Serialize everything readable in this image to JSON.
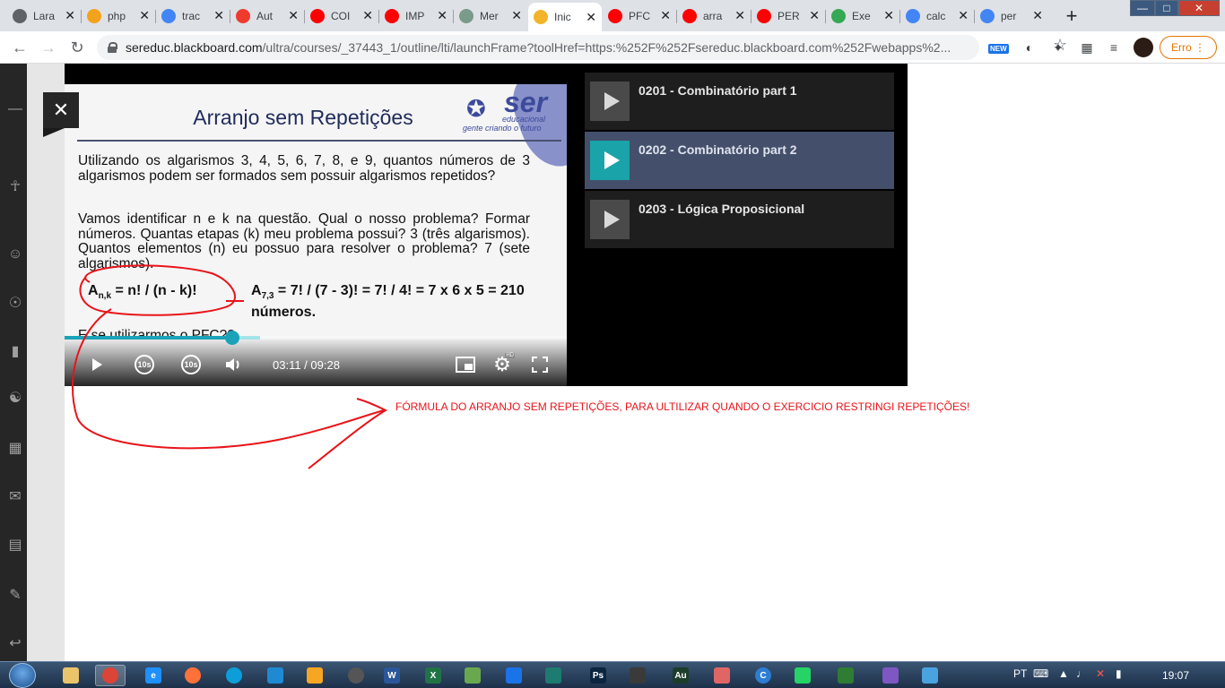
{
  "browser": {
    "tabs": [
      {
        "title": "Lara",
        "favicon": "globe-icon",
        "color": "#5f6368"
      },
      {
        "title": "php",
        "favicon": "php-icon",
        "color": "#f4a21b"
      },
      {
        "title": "trac",
        "favicon": "google-icon",
        "color": "#4285f4"
      },
      {
        "title": "Aut",
        "favicon": "laravel-icon",
        "color": "#ef3b2d"
      },
      {
        "title": "COI",
        "favicon": "youtube-icon",
        "color": "#ff0000"
      },
      {
        "title": "IMP",
        "favicon": "youtube-icon",
        "color": "#ff0000"
      },
      {
        "title": "Mer",
        "favicon": "link-icon",
        "color": "#7a9a8a"
      },
      {
        "title": "Inic",
        "favicon": "blackboard-icon",
        "color": "#f3b32a"
      },
      {
        "title": "PFC",
        "favicon": "youtube-icon",
        "color": "#ff0000"
      },
      {
        "title": "arra",
        "favicon": "youtube-icon",
        "color": "#ff0000"
      },
      {
        "title": "PER",
        "favicon": "youtube-icon",
        "color": "#ff0000"
      },
      {
        "title": "Exe",
        "favicon": "drive-icon",
        "color": "#34a853"
      },
      {
        "title": "calc",
        "favicon": "google-icon",
        "color": "#4285f4"
      },
      {
        "title": "per",
        "favicon": "google-icon",
        "color": "#4285f4"
      }
    ],
    "active_tab_index": 7,
    "url_host": "sereduc.blackboard.com",
    "url_path": "/ultra/courses/_37443_1/outline/lti/launchFrame?toolHref=https:%252F%252Fsereduc.blackboard.com%252Fwebapps%2...",
    "new_badge": "NEW",
    "error_button": "Erro"
  },
  "video": {
    "slide": {
      "title": "Arranjo sem Repetições",
      "logo_main": "ser",
      "logo_sub": "educacional",
      "logo_tagline": "gente criando o futuro",
      "para1": "Utilizando os algarismos 3, 4, 5, 6, 7, 8, e 9, quantos números de 3 algarismos podem ser formados sem possuir algarismos repetidos?",
      "para2": "Vamos identificar n e k na questão. Qual o nosso problema? Formar números. Quantas etapas (k) meu problema possui? 3 (três algarismos). Quantos elementos (n) eu possuo para resolver o problema? 7 (sete algarismos).",
      "formula_left_base": "A",
      "formula_left_sub": "n,k",
      "formula_left_rest": " = n! / (n - k)!",
      "formula_right_base": "A",
      "formula_right_sub": "7,3",
      "formula_right_rest": " = 7! / (7 - 3)! = 7! / 4! = 7 x 6 x 5 = 210 números.",
      "last_line": "E se utilizarmos o PFC??"
    },
    "progress": {
      "played_fraction": 0.3337,
      "buffered_fraction": 0.39
    },
    "rewind_label": "10s",
    "forward_label": "10s",
    "timecode": "03:11 / 09:28",
    "hd_badge": "HD"
  },
  "playlist": [
    {
      "title": "0201 - Combinatório part 1",
      "active": false
    },
    {
      "title": "0202 - Combinatório part 2",
      "active": true
    },
    {
      "title": "0203 - Lógica Proposicional",
      "active": false
    }
  ],
  "annotation": {
    "text": "FÓRMULA DO ARRANJO SEM REPETIÇÕES, PARA ULTILIZAR QUANDO O EXERCICIO RESTRINGI REPETIÇÕES!",
    "color": "#e8141a"
  },
  "taskbar": {
    "apps": [
      {
        "name": "explorer",
        "glyph": "",
        "color": "#e9c46a"
      },
      {
        "name": "chrome",
        "glyph": "",
        "color": "#db4437"
      },
      {
        "name": "internet-explorer",
        "glyph": "e",
        "color": "#1e90ff"
      },
      {
        "name": "firefox",
        "glyph": "",
        "color": "#ff7139"
      },
      {
        "name": "edge",
        "glyph": "",
        "color": "#0c9ed9"
      },
      {
        "name": "vscode",
        "glyph": "",
        "color": "#1f8ad2"
      },
      {
        "name": "media-player",
        "glyph": "",
        "color": "#f5a623"
      },
      {
        "name": "app-ball",
        "glyph": "",
        "color": "#555"
      },
      {
        "name": "word",
        "glyph": "W",
        "color": "#2b579a"
      },
      {
        "name": "excel",
        "glyph": "X",
        "color": "#217346"
      },
      {
        "name": "app-diamond",
        "glyph": "",
        "color": "#6aa84f"
      },
      {
        "name": "vpn",
        "glyph": "",
        "color": "#1a73e8"
      },
      {
        "name": "terminal",
        "glyph": "",
        "color": "#1e7b6f"
      },
      {
        "name": "photoshop",
        "glyph": "Ps",
        "color": "#0b2540"
      },
      {
        "name": "app-pin",
        "glyph": "",
        "color": "#3a3a3a"
      },
      {
        "name": "audition",
        "glyph": "Au",
        "color": "#1c3d2a"
      },
      {
        "name": "app-grid",
        "glyph": "",
        "color": "#e06666"
      },
      {
        "name": "app-c",
        "glyph": "C",
        "color": "#2d7dd2"
      },
      {
        "name": "whatsapp",
        "glyph": "",
        "color": "#25d366"
      },
      {
        "name": "app-globe",
        "glyph": "",
        "color": "#2e7d32"
      },
      {
        "name": "app-cog",
        "glyph": "",
        "color": "#7e57c2"
      },
      {
        "name": "app-flower",
        "glyph": "",
        "color": "#4aa3df"
      }
    ],
    "language": "PT",
    "time": "19:07"
  }
}
